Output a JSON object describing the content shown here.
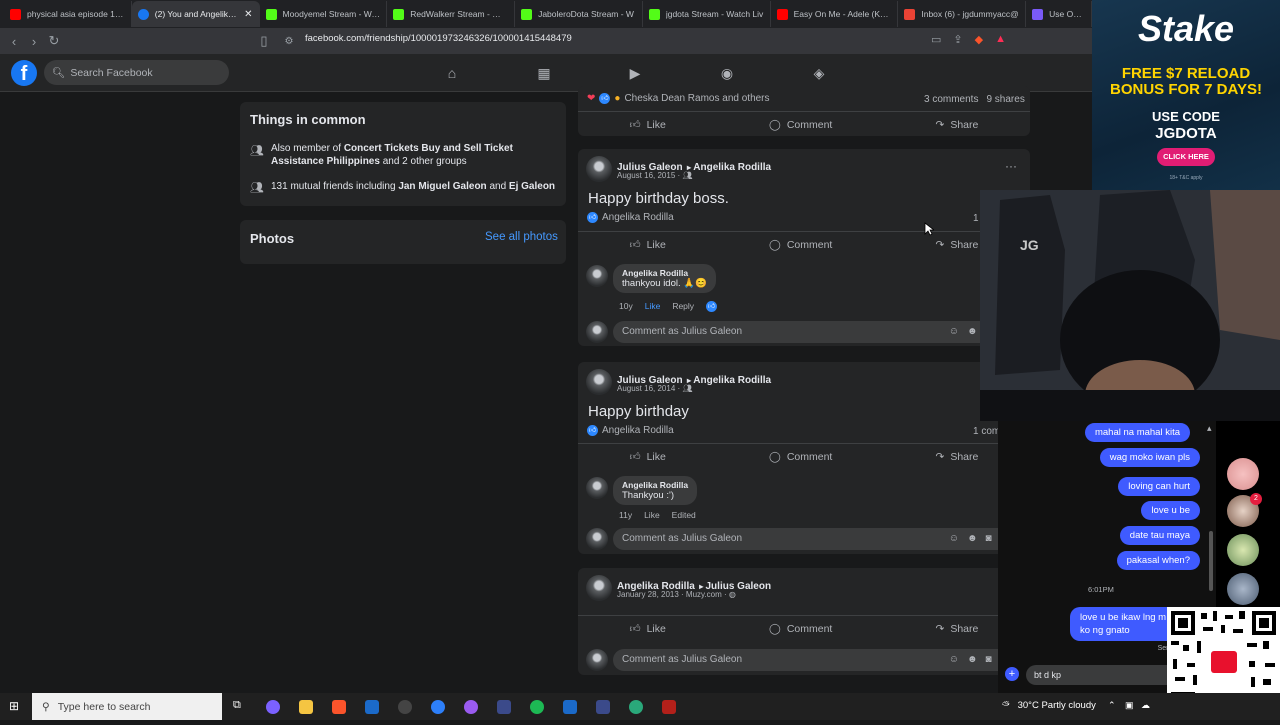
{
  "browser": {
    "tabs": [
      {
        "title": "physical asia episode 1 - Y",
        "color": "#ff0000"
      },
      {
        "title": "(2) You and Angelika R",
        "color": "#1877f2"
      },
      {
        "title": "Moodyemel Stream - Watc",
        "color": "#53fc18"
      },
      {
        "title": "RedWalkerr Stream - Watc",
        "color": "#53fc18"
      },
      {
        "title": "JaboleroDota Stream - W",
        "color": "#53fc18"
      },
      {
        "title": "jgdota Stream - Watch Liv",
        "color": "#53fc18"
      },
      {
        "title": "Easy On Me - Adele (Kara",
        "color": "#ff0000"
      },
      {
        "title": "Inbox (6) - jgdummyacc@",
        "color": "#ea4335"
      },
      {
        "title": "Use OTP To Pro",
        "color": "#7a5af8"
      }
    ],
    "url": "facebook.com/friendship/100001973246326/100001415448479"
  },
  "facebook": {
    "search_placeholder": "Search Facebook",
    "things_in_common": {
      "title": "Things in common",
      "member_prefix": "Also member of ",
      "group_name": "Concert Tickets Buy and Sell Ticket Assistance Philippines",
      "member_suffix": " and 2 other groups",
      "mutual_prefix": "131 mutual friends including ",
      "friend1": "Jan Miguel Galeon",
      "and": " and ",
      "friend2": "Ej Galeon"
    },
    "photos": {
      "title": "Photos",
      "see_all": "See all photos"
    },
    "top_post": {
      "reactors": "Cheska Dean Ramos and others",
      "comments": "3 comments",
      "shares": "9 shares"
    },
    "actions": {
      "like": "Like",
      "comment": "Comment",
      "share": "Share"
    },
    "posts": [
      {
        "author": "Julius Galeon",
        "target": "Angelika Rodilla",
        "date": "August 16, 2015 ·",
        "text": "Happy birthday boss.",
        "liker": "Angelika Rodilla",
        "count_partial": "1",
        "comment": {
          "name": "Angelika Rodilla",
          "text": "thankyou idol. 🙏😊",
          "age": "10y",
          "like": "Like",
          "reply": "Reply"
        },
        "comment_placeholder": "Comment as Julius Galeon"
      },
      {
        "author": "Julius Galeon",
        "target": "Angelika Rodilla",
        "date": "August 16, 2014 ·",
        "text": "Happy birthday",
        "liker": "Angelika Rodilla",
        "count_partial": "1 com",
        "comment": {
          "name": "Angelika Rodilla",
          "text": "Thankyou :')",
          "age": "11y",
          "like": "Like",
          "reply": "Edited"
        },
        "comment_placeholder": "Comment as Julius Galeon"
      },
      {
        "author": "Angelika Rodilla",
        "target": "Julius Galeon",
        "date": "January 28, 2013 · Muzy.com ·",
        "comment_placeholder": "Comment as Julius Galeon"
      }
    ]
  },
  "stream": {
    "stake": {
      "logo": "Stake",
      "line1": "FREE $7 RELOAD",
      "line2": "BONUS FOR 7 DAYS!",
      "line3": "USE CODE",
      "code": "JGDOTA",
      "cta": "CLICK HERE",
      "fine": "18+ T&C apply"
    },
    "chat_messages": [
      "mahal na mahal kita",
      "wag moko iwan pls",
      "loving can hurt",
      "love u be",
      "date tau maya",
      "pakasal when?"
    ],
    "chat_time": "6:01PM",
    "chat_last": "love u be ikaw lng m ko ng gnato",
    "chat_sent": "Sent",
    "chat_draft": "bt d  kp",
    "unread_badge": "2"
  },
  "taskbar": {
    "search_placeholder": "Type here to search",
    "weather": "30°C  Partly cloudy"
  }
}
